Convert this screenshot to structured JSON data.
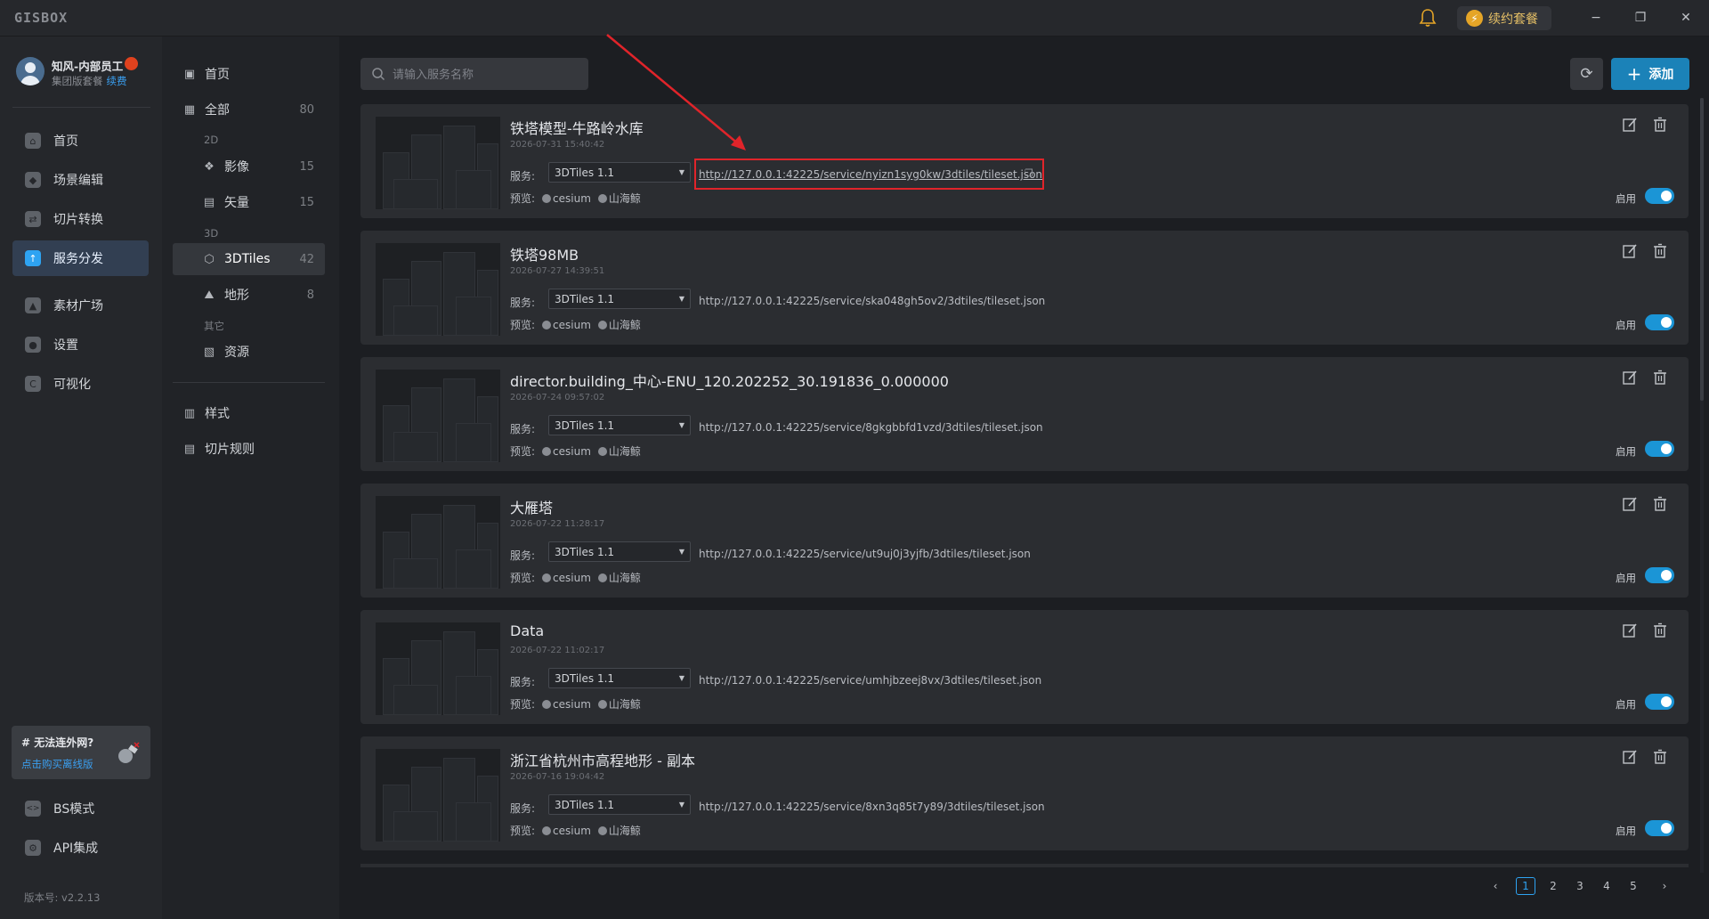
{
  "window": {
    "logo": "GISBOX",
    "renew_label": "续约套餐",
    "renew_icon": "lightning-icon",
    "minimize": "−",
    "restore": "❐",
    "close": "✕"
  },
  "user": {
    "name": "知风-内部员工",
    "plan": "集团版套餐",
    "renew_link": "续费"
  },
  "sidebar": {
    "items": [
      {
        "label": "首页",
        "icon": "home-icon",
        "glyph": "⌂"
      },
      {
        "label": "场景编辑",
        "icon": "cube-icon",
        "glyph": "◆"
      },
      {
        "label": "切片转换",
        "icon": "convert-icon",
        "glyph": "⇄"
      },
      {
        "label": "服务分发",
        "icon": "cloud-upload-icon",
        "glyph": "↑",
        "active": true
      },
      {
        "label": "素材广场",
        "icon": "image-icon",
        "glyph": "▲"
      },
      {
        "label": "设置",
        "icon": "gear-icon",
        "glyph": "●"
      },
      {
        "label": "可视化",
        "icon": "visualize-icon",
        "glyph": "C"
      }
    ],
    "bottom_items": [
      {
        "label": "BS模式",
        "icon": "code-icon",
        "glyph": "<>"
      },
      {
        "label": "API集成",
        "icon": "api-icon",
        "glyph": "⚙"
      }
    ],
    "offline": {
      "title": "# 无法连外网?",
      "link": "点击购买离线版"
    },
    "version": "版本号: v2.2.13"
  },
  "subnav": {
    "home": "首页",
    "all": {
      "label": "全部",
      "count": "80"
    },
    "group_2d": "2D",
    "imagery": {
      "label": "影像",
      "count": "15"
    },
    "vector": {
      "label": "矢量",
      "count": "15"
    },
    "group_3d": "3D",
    "tiles3d": {
      "label": "3DTiles",
      "count": "42"
    },
    "terrain": {
      "label": "地形",
      "count": "8"
    },
    "group_other": "其它",
    "resource": {
      "label": "资源"
    },
    "style": {
      "label": "样式"
    },
    "tile_rules": {
      "label": "切片规则"
    }
  },
  "toolbar": {
    "search_placeholder": "请输入服务名称",
    "add_label": "添加"
  },
  "labels": {
    "service": "服务:",
    "preview": "预览:",
    "preview_cesium": "cesium",
    "preview_shanhai": "山海鲸",
    "enable": "启用"
  },
  "services": [
    {
      "title": "铁塔模型-牛路岭水库",
      "date": "2026-07-31 15:40:42",
      "type": "3DTiles 1.1",
      "url": "http://127.0.0.1:42225/service/nyizn1syg0kw/3dtiles/tileset.json",
      "enabled": true,
      "highlighted": true
    },
    {
      "title": "铁塔98MB",
      "date": "2026-07-27 14:39:51",
      "type": "3DTiles 1.1",
      "url": "http://127.0.0.1:42225/service/ska048gh5ov2/3dtiles/tileset.json",
      "enabled": true
    },
    {
      "title": "director.building_中心-ENU_120.202252_30.191836_0.000000",
      "date": "2026-07-24 09:57:02",
      "type": "3DTiles 1.1",
      "url": "http://127.0.0.1:42225/service/8gkgbbfd1vzd/3dtiles/tileset.json",
      "enabled": true
    },
    {
      "title": "大雁塔",
      "date": "2026-07-22 11:28:17",
      "type": "3DTiles 1.1",
      "url": "http://127.0.0.1:42225/service/ut9uj0j3yjfb/3dtiles/tileset.json",
      "enabled": true
    },
    {
      "title": "Data",
      "date": "2026-07-22 11:02:17",
      "type": "3DTiles 1.1",
      "url": "http://127.0.0.1:42225/service/umhjbzeej8vx/3dtiles/tileset.json",
      "enabled": true
    },
    {
      "title": "浙江省杭州市高程地形 - 副本",
      "date": "2026-07-16 19:04:42",
      "type": "3DTiles 1.1",
      "url": "http://127.0.0.1:42225/service/8xn3q85t7y89/3dtiles/tileset.json",
      "enabled": true
    }
  ],
  "pagination": {
    "prev": "‹",
    "pages": [
      "1",
      "2",
      "3",
      "4",
      "5"
    ],
    "current": "1",
    "next": "›"
  },
  "colors": {
    "accent": "#1b95d6",
    "annotation_red": "#e0242a"
  }
}
